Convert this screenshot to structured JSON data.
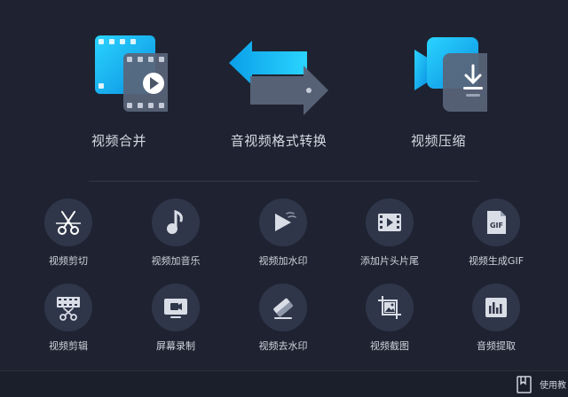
{
  "features": [
    {
      "label": "视频合并",
      "icon": "video-merge-icon"
    },
    {
      "label": "音视频格式转换",
      "icon": "format-convert-icon"
    },
    {
      "label": "视频压缩",
      "icon": "video-compress-icon"
    }
  ],
  "tools_row1": [
    {
      "label": "视频剪切",
      "icon": "scissors-icon"
    },
    {
      "label": "视频加音乐",
      "icon": "music-note-icon"
    },
    {
      "label": "视频加水印",
      "icon": "watermark-play-icon"
    },
    {
      "label": "添加片头片尾",
      "icon": "film-strip-icon"
    },
    {
      "label": "视频生成GIF",
      "icon": "gif-icon"
    }
  ],
  "tools_row2": [
    {
      "label": "视频剪辑",
      "icon": "film-cut-icon"
    },
    {
      "label": "屏幕录制",
      "icon": "screen-record-icon"
    },
    {
      "label": "视频去水印",
      "icon": "eraser-icon"
    },
    {
      "label": "视频截图",
      "icon": "screenshot-crop-icon"
    },
    {
      "label": "音频提取",
      "icon": "audio-extract-icon"
    }
  ],
  "gif_badge": "GIF",
  "bottom": {
    "guide_label": "使用教",
    "icon": "book-icon"
  },
  "colors": {
    "background": "#1f2331",
    "accent": "#18c3f5",
    "circle": "#30364a"
  }
}
